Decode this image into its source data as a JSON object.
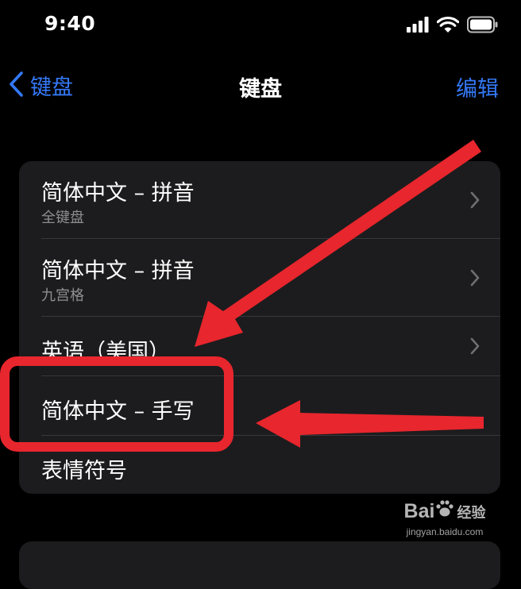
{
  "status_bar": {
    "time": "9:40",
    "icons": [
      "cellular-signal-icon",
      "wifi-icon",
      "battery-icon"
    ]
  },
  "nav": {
    "back_label": "键盘",
    "title": "键盘",
    "edit_label": "编辑"
  },
  "keyboards": [
    {
      "title": "简体中文 – 拼音",
      "subtitle": "全键盘",
      "has_chevron": true
    },
    {
      "title": "简体中文 – 拼音",
      "subtitle": "九宫格",
      "has_chevron": true
    },
    {
      "title": "英语（美国）",
      "subtitle": "",
      "has_chevron": true
    },
    {
      "title": "简体中文 – 手写",
      "subtitle": "",
      "has_chevron": false
    },
    {
      "title": "表情符号",
      "subtitle": "",
      "has_chevron": false
    }
  ],
  "annotation": {
    "color": "#e8262d",
    "highlighted_item": "简体中文 – 手写"
  },
  "watermark": {
    "logo_text": "Bai",
    "logo_text_end": "经验",
    "url": "jingyan.baidu.com"
  },
  "colors": {
    "accent": "#3478f6",
    "background": "#000000",
    "group_background": "#1c1c1e",
    "secondary_text": "#8e8e93"
  }
}
